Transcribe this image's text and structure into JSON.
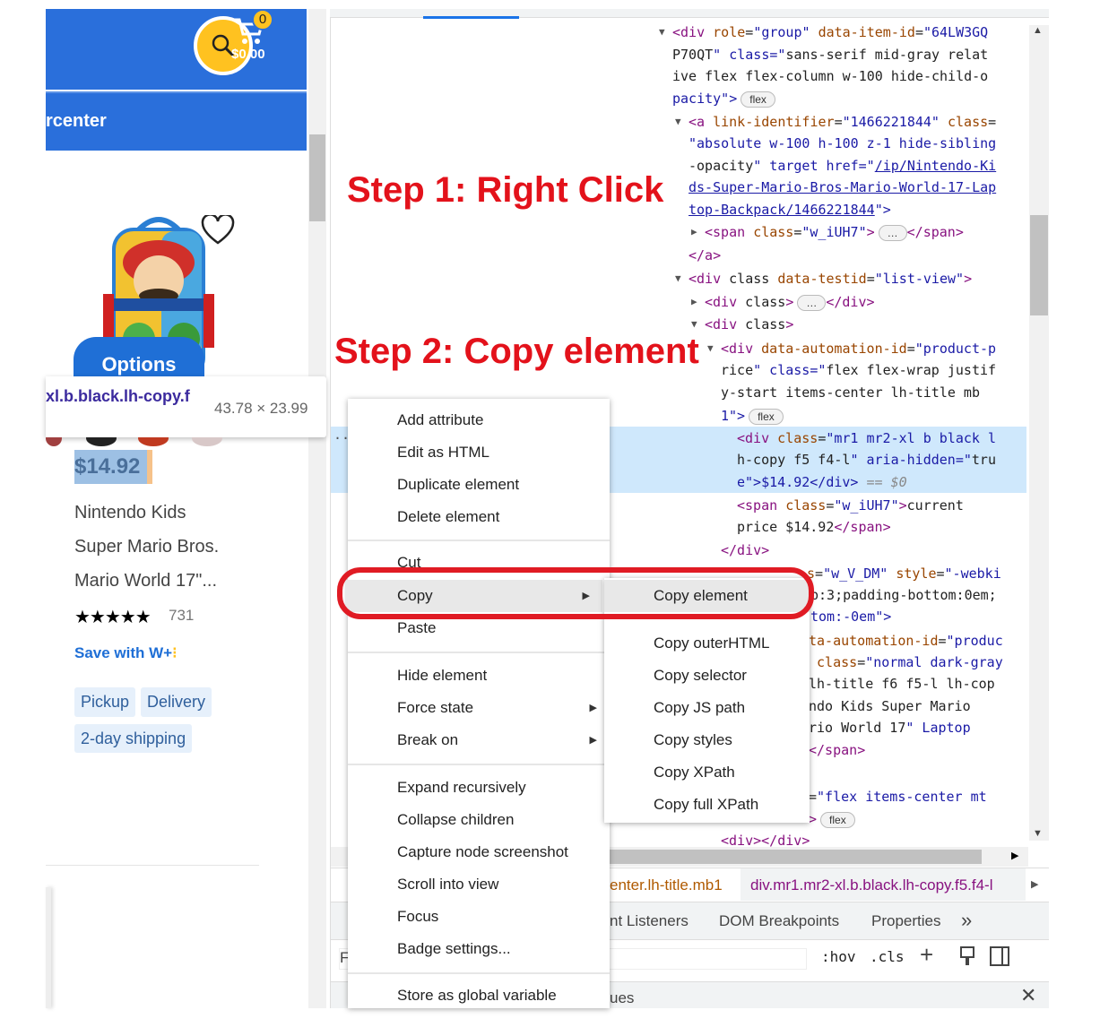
{
  "page": {
    "cart_total": "$0.00",
    "cart_count": "0",
    "department": "rcenter",
    "options_label": "Options",
    "tooltip_selector": "xl.b.black.lh-copy.f",
    "tooltip_dimensions": "43.78 × 23.99",
    "price": "$14.92",
    "title_lines": [
      "Nintendo Kids",
      "Super Mario Bros.",
      "Mario World 17\"..."
    ],
    "stars": "★★★★★",
    "rating_value": 5,
    "review_count": "731",
    "save_with": "Save with W+",
    "chips": [
      "Pickup",
      "Delivery",
      "2-day shipping"
    ],
    "colors": {
      "brand_blue": "#2a6fdb",
      "brand_yellow": "#ffc220",
      "annotation_red": "#e3121b"
    }
  },
  "annotations": {
    "step1": "Step 1: Right Click",
    "step2": "Step 2: Copy element"
  },
  "elements_panel": {
    "lines": [
      {
        "t": "▼",
        "s": "<div role=\"group\" data-item-id=\"64LW3GQ"
      },
      {
        "s": "P70QT\" class=\"sans-serif mid-gray relat"
      },
      {
        "s": "ive flex flex-column w-100 hide-child-o"
      },
      {
        "s": "pacity\">",
        "badge": "flex"
      },
      {
        "t": "▼",
        "s": "<a link-identifier=\"1466221844\" class="
      },
      {
        "s": "\"absolute w-100 h-100 z-1 hide-sibling"
      },
      {
        "s": "-opacity\" target href=\"",
        "link": "/ip/Nintendo-Ki"
      },
      {
        "link": "ds-Super-Mario-Bros-Mario-World-17-Lap"
      },
      {
        "link": "top-Backpack/1466221844",
        "s2": "\">"
      },
      {
        "t": "▶",
        "s": "<span class=\"w_iUH7\">",
        "badge": "…",
        "s2": "</span>"
      },
      {
        "s": "</a>"
      },
      {
        "t": "▼",
        "s": "<div class data-testid=\"list-view\">"
      },
      {
        "t": "▶",
        "s": "<div class>",
        "badge": "…",
        "s2": "</div>"
      },
      {
        "t": "▼",
        "s": "<div class>"
      },
      {
        "t": "▼",
        "s": "<div data-automation-id=\"product-p"
      },
      {
        "s": "rice\" class=\"flex flex-wrap justif"
      },
      {
        "s": "y-start items-center lh-title mb"
      },
      {
        "s": "1\">",
        "badge": "flex"
      },
      {
        "s": "<div class=\"mr1 mr2-xl b black l"
      },
      {
        "s": "h-copy f5 f4-l\" aria-hidden=\"tru"
      },
      {
        "s": "e\">$14.92</div>",
        "s2": " == $0"
      },
      {
        "s": "<span class=\"w_iUH7\">current"
      },
      {
        "s": "price $14.92</span>"
      },
      {
        "s": "</div>"
      },
      {
        "s": "s=\"w_V_DM\" style=\"-webki"
      },
      {
        "s": "p:3;padding-bottom:0em;"
      },
      {
        "s": "tom:-0em\">"
      },
      {
        "s": "ta-automation-id=\"produc"
      },
      {
        "s": " class=\"normal dark-gray"
      },
      {
        "s": "lh-title f6 f5-l lh-cop"
      },
      {
        "s": "ndo Kids Super Mario"
      },
      {
        "s": "rio World 17\" Laptop"
      },
      {
        "s": "</span>"
      },
      {
        "s": "=\"flex items-center mt"
      },
      {
        "s": ">",
        "badge": "flex"
      },
      {
        "s": "<div></div>"
      }
    ],
    "selected_marker": "...",
    "breadcrumbs": [
      "enter.lh-title.mb1",
      "div.mr1.mr2-xl.b.black.lh-copy.f5.f4-l"
    ],
    "tabs": [
      "nt Listeners",
      "DOM Breakpoints",
      "Properties",
      "»"
    ],
    "filter_placeholder": "F",
    "hov": ":hov",
    "cls": ".cls",
    "bottom_tab": "ues"
  },
  "context_menu": {
    "items": [
      "Add attribute",
      "Edit as HTML",
      "Duplicate element",
      "Delete element",
      "Cut",
      "Copy",
      "Paste",
      "Hide element",
      "Force state",
      "Break on",
      "Expand recursively",
      "Collapse children",
      "Capture node screenshot",
      "Scroll into view",
      "Focus",
      "Badge settings...",
      "Store as global variable"
    ],
    "highlighted": "Copy",
    "submenu": [
      "Copy element",
      "Copy outerHTML",
      "Copy selector",
      "Copy JS path",
      "Copy styles",
      "Copy XPath",
      "Copy full XPath"
    ],
    "submenu_highlighted": "Copy element"
  }
}
